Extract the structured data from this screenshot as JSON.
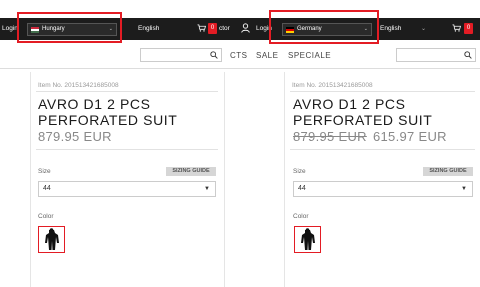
{
  "left_panel": {
    "header": {
      "login_label": "Login",
      "country": "Hungary",
      "language": "English",
      "cart_count": "0",
      "trailing_text": "ctor"
    },
    "nav": {
      "items": [
        "CTS",
        "SALE",
        "SPECIALE"
      ]
    },
    "product": {
      "item_no": "Item No. 201513421685008",
      "title_line1": "AVRO D1 2 PCS",
      "title_line2": "PERFORATED SUIT",
      "price": "879.95 EUR",
      "size_label": "Size",
      "sizing_guide": "SIZING GUIDE",
      "size_value": "44",
      "color_label": "Color"
    }
  },
  "right_panel": {
    "header": {
      "login_label": "Login",
      "country": "Germany",
      "language": "English",
      "cart_count": "0"
    },
    "product": {
      "item_no": "Item No. 201513421685008",
      "title_line1": "AVRO D1 2 PCS",
      "title_line2": "PERFORATED SUIT",
      "price_old": "879.95 EUR",
      "price_new": "615.97 EUR",
      "size_label": "Size",
      "sizing_guide": "SIZING GUIDE",
      "size_value": "44",
      "color_label": "Color"
    }
  },
  "colors": {
    "highlight": "#e31c24",
    "topbar": "#1c1c1c",
    "badge": "#e31c24"
  }
}
